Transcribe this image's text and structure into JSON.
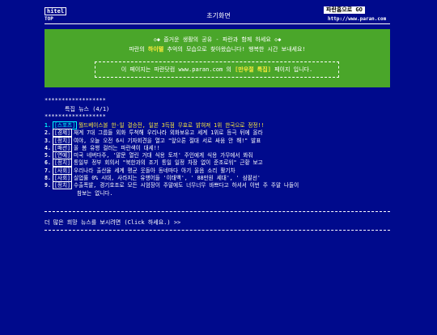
{
  "header": {
    "logo": "hitel",
    "top_link": "TOP",
    "title": "초기화면",
    "home_button": "파란홈으로 GO",
    "url": "http://www.paran.com"
  },
  "banner": {
    "line1": "◇◆  즐거운 생활의 공유 - 파란과 함께 하세요  ◇◆",
    "line2_pre": "파란의 ",
    "line2_hl": "하이텔",
    "line2_post": " 추억의 모습으로 찾아왔습니다! 행복한 시간 보내세요!",
    "notice_pre": "이 페이지는 파란닷컴 www.paran.com 의 ",
    "notice_hl": "[만우절 특집]",
    "notice_post": " 페이지 입니다."
  },
  "stars": "******************",
  "section_title": "특집 뉴스 (4/1)",
  "news": [
    {
      "num": "1.",
      "tag": "[스포츠]",
      "text": "월드베이스볼 한-일 결승전, 일본 3득점 무효로 밝혀져 1위 한국으로 정정!!"
    },
    {
      "num": "2.",
      "tag": "[경제]",
      "text": "재계 7대 그룹들 외화 투척해 우리나라 외화보유고 세계 1위로 등극 뒤에 올라"
    },
    {
      "num": "3.",
      "tag": "[정치]",
      "text": "여야, 오늘 오전 6시 기자회견을 열고 \"앞으론 절대 서로 싸움 안 해!\" 발표"
    },
    {
      "num": "4.",
      "tag": "[패션]",
      "text": "올 봄 유행 컬러는 파란색이 대세!!"
    },
    {
      "num": "5.",
      "tag": "[연예]",
      "text": "미국 네버다주, '말문 열린 거대 식용 토끼' 주인에게 식용 가무에서 봐줘"
    },
    {
      "num": "6.",
      "tag": "[정치]",
      "text": "통일부 정부 회의서 \"북한과의 조기 통일 일정 차장 없이 준조로워\" 근황 보고"
    },
    {
      "num": "7.",
      "tag": "[사회]",
      "text": "우리나라 출산율 세계 평균 웃돌아 동네마다 아기 울음 소리 활기차"
    },
    {
      "num": "8.",
      "tag": "[사회]",
      "text": "실업률 0% 시대, 사라지는 유행어들 '이태백', ' 88만원 세대', ' 삼팔선'"
    },
    {
      "num": "9.",
      "tag": "[정치]",
      "text": "수출폭발, 경기호조로 모든 시엄장이 주말에도 너무너무 바쁘다고 하셔서 이번 주 주말 나들이",
      "cont": "참보는 없니다."
    }
  ],
  "more_text": "더 많은 희망 뉴스를 보시려면 (Click 하세요.)  >>"
}
